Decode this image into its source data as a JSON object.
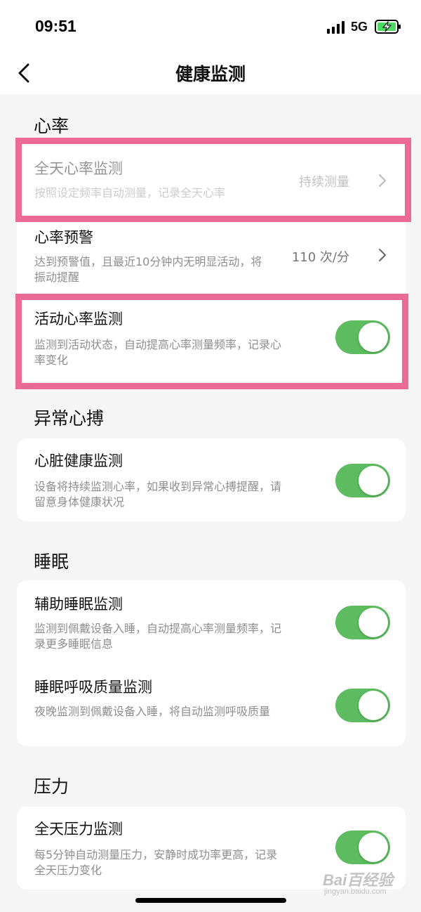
{
  "status_bar": {
    "time": "09:51",
    "network": "5G"
  },
  "nav": {
    "title": "健康监测"
  },
  "sections": [
    {
      "title": "心率",
      "rows": [
        {
          "title": "全天心率监测",
          "desc": "按照设定频率自动测量，记录全天心率",
          "value": "持续测量",
          "control": "chevron",
          "dimmed": true,
          "highlighted": true
        },
        {
          "title": "心率预警",
          "desc": "达到预警值，且最近10分钟内无明显活动，将振动提醒",
          "value": "110 次/分",
          "control": "chevron",
          "dimmed": false
        },
        {
          "title": "活动心率监测",
          "desc": "监测到活动状态，自动提高心率测量频率，记录心率变化",
          "control": "toggle",
          "checked": true,
          "highlighted": true
        }
      ]
    },
    {
      "title": "异常心搏",
      "rows": [
        {
          "title": "心脏健康监测",
          "desc": "设备将持续监测心率，如果收到异常心搏提醒，请留意身体健康状况",
          "control": "toggle",
          "checked": true
        }
      ]
    },
    {
      "title": "睡眠",
      "rows": [
        {
          "title": "辅助睡眠监测",
          "desc": "监测到佩戴设备入睡，自动提高心率测量频率，记录更多睡眠信息",
          "control": "toggle",
          "checked": true
        },
        {
          "title": "睡眠呼吸质量监测",
          "desc": "夜晚监测到佩戴设备入睡，将自动监测呼吸质量",
          "control": "toggle",
          "checked": true
        }
      ]
    },
    {
      "title": "压力",
      "rows": [
        {
          "title": "全天压力监测",
          "desc": "每5分钟自动测量压力，安静时成功率更高，记录全天压力变化",
          "control": "toggle",
          "checked": true
        }
      ]
    }
  ],
  "watermark": {
    "main": "Bai百经验",
    "sub": "jingyan.baidu.com"
  },
  "colors": {
    "toggle_on": "#5cbc5f",
    "highlight": "#ec6a96",
    "background": "#f5f5f5"
  },
  "icons": {
    "back": "chevron-left-icon",
    "row_arrow": "chevron-right-icon",
    "battery": "battery-charging-icon",
    "signal": "signal-bars-icon"
  }
}
